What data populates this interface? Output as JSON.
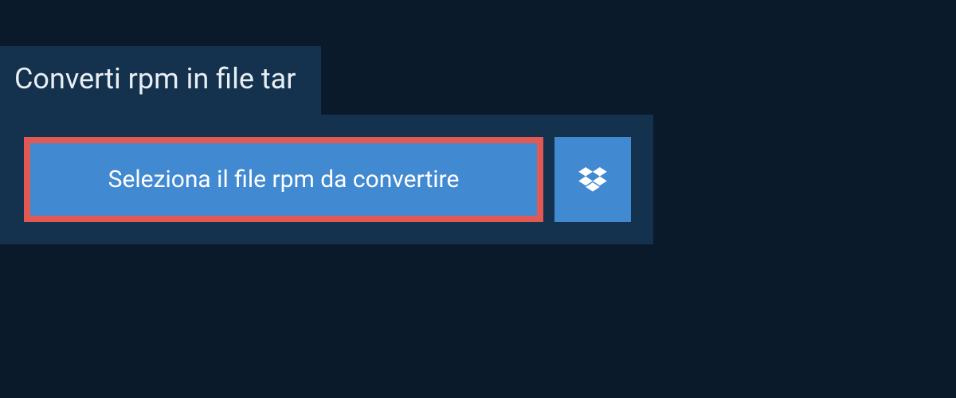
{
  "tab": {
    "title": "Converti rpm in file tar"
  },
  "actions": {
    "select_file_label": "Seleziona il file rpm da convertire"
  }
}
